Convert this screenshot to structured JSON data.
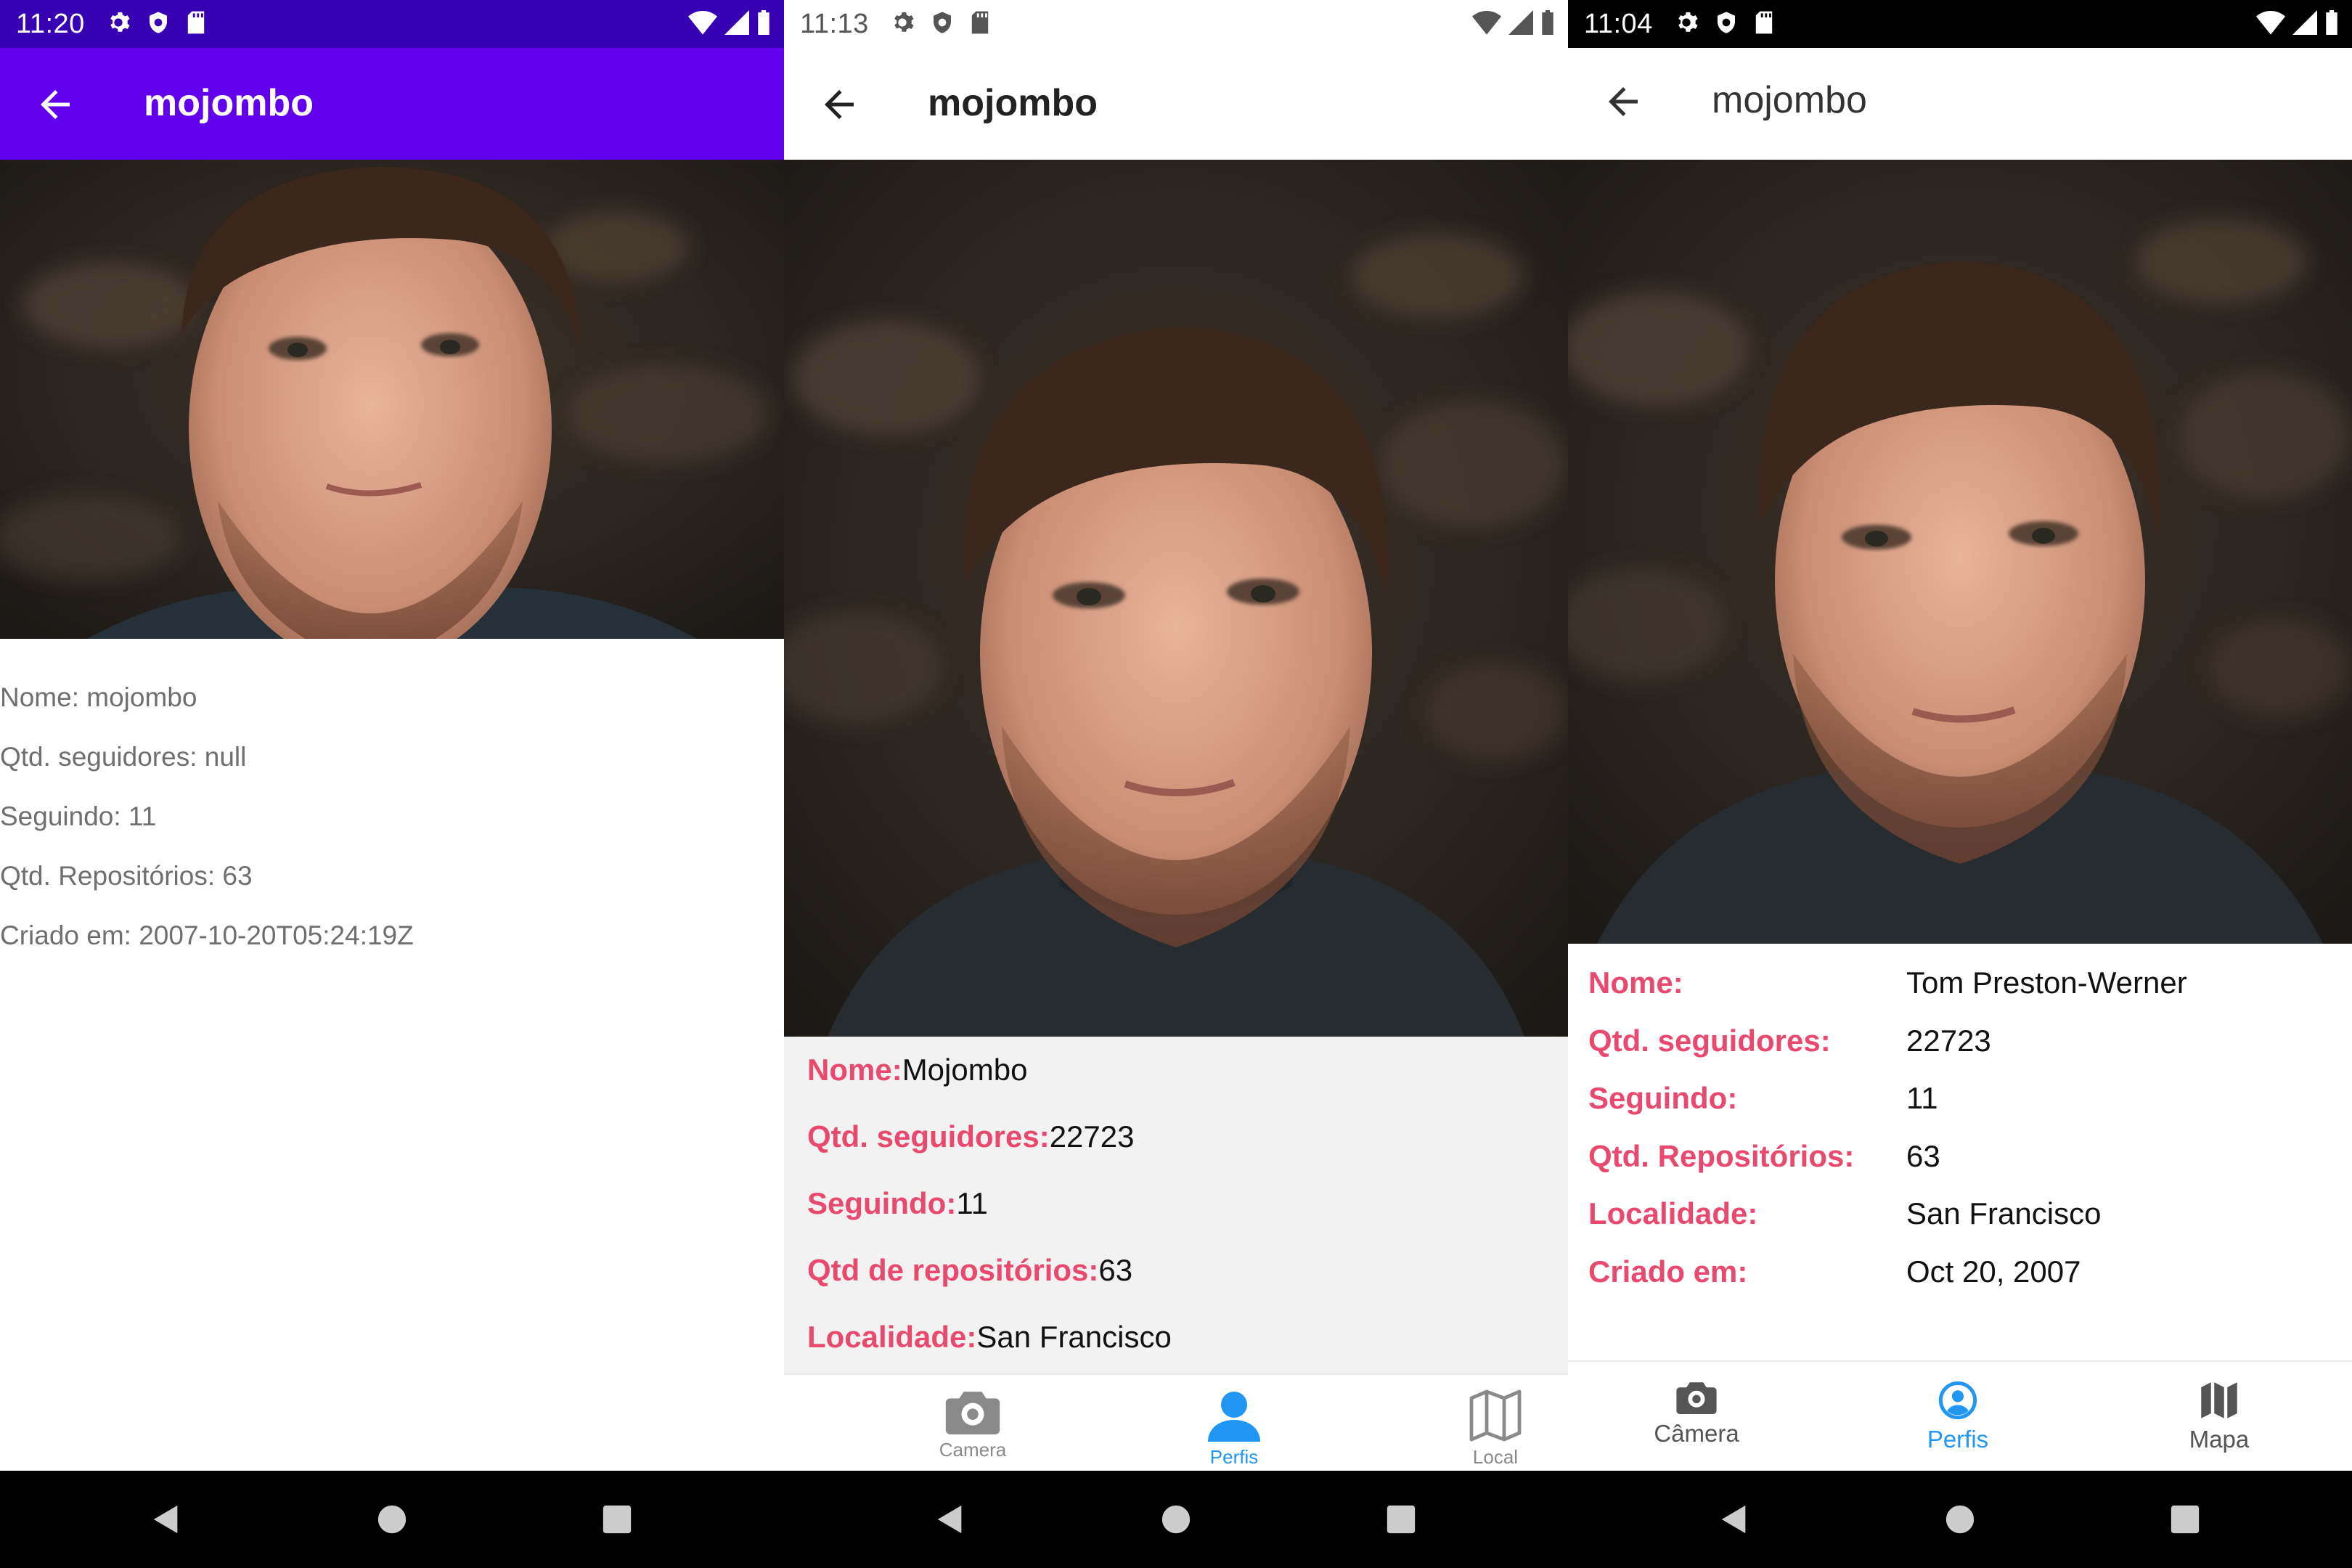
{
  "colors": {
    "primary": "#6200ee",
    "primary_dark": "#3700b3",
    "label_pink": "#e8496d",
    "tab_active": "#2196f3",
    "tab_inactive": "#8a8a8a",
    "info_bg": "#f2f2f2"
  },
  "screens": [
    {
      "status_time": "11:20",
      "title": "mojombo",
      "info": [
        "Nome: mojombo",
        "Qtd. seguidores: null",
        "Seguindo: 11",
        "Qtd. Repositórios: 63",
        "Criado em: 2007-10-20T05:24:19Z"
      ]
    },
    {
      "status_time": "11:13",
      "title": "mojombo",
      "info": [
        {
          "label": "Nome:",
          "value": "Mojombo"
        },
        {
          "label": "Qtd. seguidores:",
          "value": "22723"
        },
        {
          "label": "Seguindo:",
          "value": "11"
        },
        {
          "label": "Qtd de repositórios:",
          "value": "63"
        },
        {
          "label": "Localidade:",
          "value": "San Francisco"
        }
      ],
      "tabs": [
        {
          "label": "Camera",
          "icon": "camera-icon"
        },
        {
          "label": "Perfis",
          "icon": "person-icon",
          "active": true
        },
        {
          "label": "Local",
          "icon": "map-icon"
        }
      ]
    },
    {
      "status_time": "11:04",
      "title": "mojombo",
      "info": [
        {
          "label": "Nome:",
          "value": "Tom Preston-Werner"
        },
        {
          "label": "Qtd. seguidores:",
          "value": "22723"
        },
        {
          "label": "Seguindo:",
          "value": "11"
        },
        {
          "label": "Qtd. Repositórios:",
          "value": "63"
        },
        {
          "label": "Localidade:",
          "value": "San Francisco"
        },
        {
          "label": "Criado em:",
          "value": "Oct 20, 2007"
        }
      ],
      "tabs": [
        {
          "label": "Câmera",
          "icon": "camera-icon"
        },
        {
          "label": "Perfis",
          "icon": "account-circle-icon",
          "active": true
        },
        {
          "label": "Mapa",
          "icon": "map-icon"
        }
      ]
    }
  ]
}
